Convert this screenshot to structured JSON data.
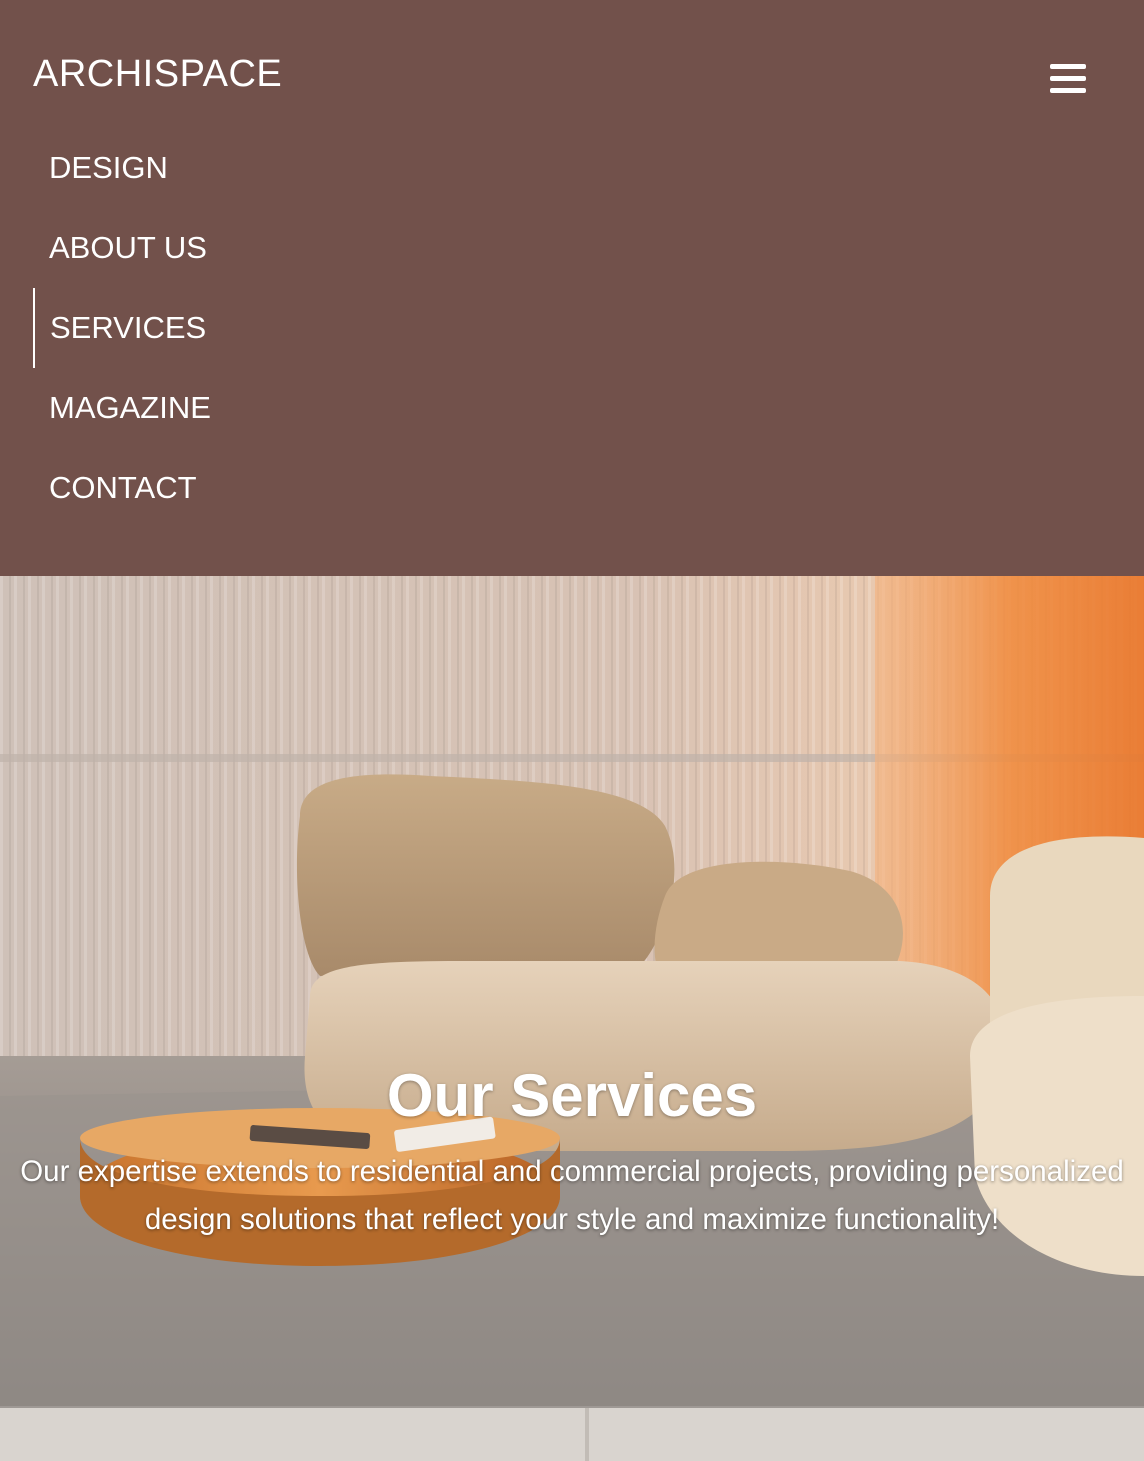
{
  "header": {
    "logo": "ARCHISPACE",
    "menu_icon": "hamburger-menu-icon"
  },
  "nav": {
    "items": [
      {
        "label": "DESIGN",
        "active": false
      },
      {
        "label": "ABOUT US",
        "active": false
      },
      {
        "label": "SERVICES",
        "active": true
      },
      {
        "label": "MAGAZINE",
        "active": false
      },
      {
        "label": "CONTACT",
        "active": false
      }
    ]
  },
  "hero": {
    "title": "Our Services",
    "description": "Our expertise extends to residential and commercial projects, providing personalized design solutions that reflect your style and maximize functionality!"
  },
  "colors": {
    "header_bg": "#72514b",
    "text": "#ffffff",
    "accent_orange": "#f08a3c"
  }
}
